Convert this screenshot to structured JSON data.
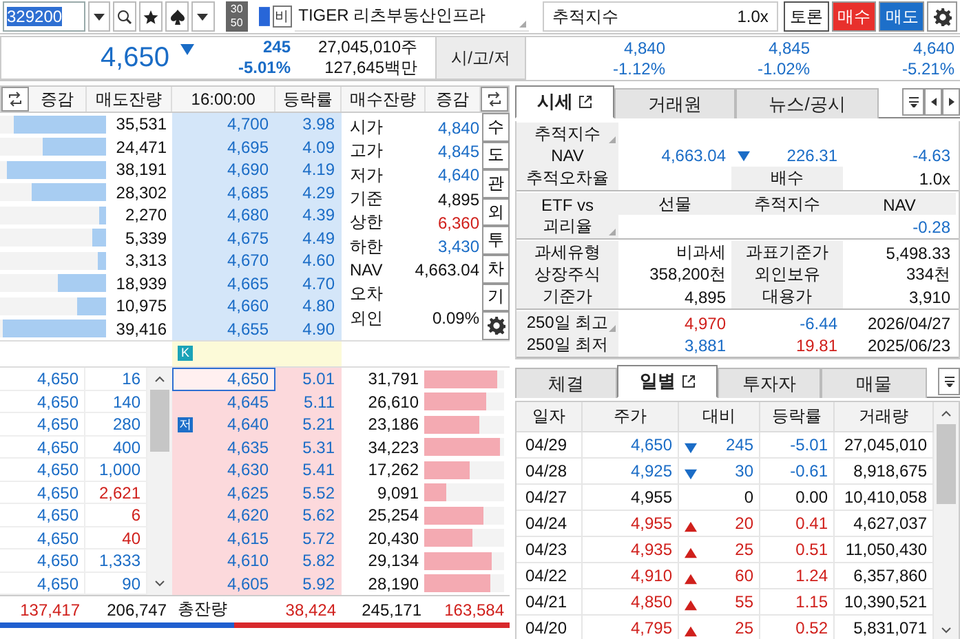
{
  "toolbar": {
    "code": "329200",
    "badge": [
      "30",
      "50"
    ],
    "tag": "비",
    "name": "TIGER 리츠부동산인프라",
    "index_label": "추적지수",
    "multiplier": "1.0x",
    "buttons": [
      {
        "label": "토론",
        "kind": "plain"
      },
      {
        "label": "매수",
        "kind": "buy"
      },
      {
        "label": "매도",
        "kind": "sell"
      }
    ]
  },
  "quote": {
    "price": "4,650",
    "falling": true,
    "change": "245",
    "rate": "-5.01%",
    "volume": "27,045,010주",
    "amount": "127,645백만",
    "ohl_button": "시/고/저",
    "ohl": [
      {
        "price": "4,840",
        "rate": "-1.12%"
      },
      {
        "price": "4,845",
        "rate": "-1.02%"
      },
      {
        "price": "4,640",
        "rate": "-5.21%"
      }
    ]
  },
  "orderbook": {
    "columns": [
      "증감",
      "매도잔량",
      "16:00:00",
      "등락률",
      "매수잔량",
      "증감"
    ],
    "asks": [
      {
        "qty": "35,531",
        "price": "4,700",
        "rate": "3.98",
        "level": 0.87
      },
      {
        "qty": "24,471",
        "price": "4,695",
        "rate": "4.09",
        "level": 0.6
      },
      {
        "qty": "38,191",
        "price": "4,690",
        "rate": "4.19",
        "level": 0.94
      },
      {
        "qty": "28,302",
        "price": "4,685",
        "rate": "4.29",
        "level": 0.7
      },
      {
        "qty": "2,270",
        "price": "4,680",
        "rate": "4.39",
        "level": 0.06
      },
      {
        "qty": "5,339",
        "price": "4,675",
        "rate": "4.49",
        "level": 0.13
      },
      {
        "qty": "3,313",
        "price": "4,670",
        "rate": "4.60",
        "level": 0.08
      },
      {
        "qty": "18,939",
        "price": "4,665",
        "rate": "4.70",
        "level": 0.46
      },
      {
        "qty": "10,975",
        "price": "4,660",
        "rate": "4.80",
        "level": 0.27
      },
      {
        "qty": "39,416",
        "price": "4,655",
        "rate": "4.90",
        "level": 0.97
      }
    ],
    "info": [
      {
        "label": "시가",
        "value": "4,840",
        "color": "#1a6cc6"
      },
      {
        "label": "고가",
        "value": "4,845",
        "color": "#1a6cc6"
      },
      {
        "label": "저가",
        "value": "4,640",
        "color": "#1a6cc6"
      },
      {
        "label": "기준",
        "value": "4,895",
        "color": "#111111"
      },
      {
        "label": "상한",
        "value": "6,360",
        "color": "#d0201c"
      },
      {
        "label": "하한",
        "value": "3,430",
        "color": "#1a6cc6"
      },
      {
        "label": "NAV",
        "value": "4,663.04",
        "color": "#111111"
      },
      {
        "label": "오차"
      },
      {
        "label": "외인",
        "value": "0.09%",
        "color": "#111111"
      }
    ],
    "side_buttons": [
      "수",
      "도",
      "관",
      "외",
      "투",
      "차",
      "기"
    ],
    "marker": "K",
    "bids": [
      {
        "price": "4,650",
        "rate": "5.01",
        "qty": "31,791",
        "level": 0.92,
        "current": true
      },
      {
        "price": "4,645",
        "rate": "5.11",
        "qty": "26,610",
        "level": 0.78,
        "current": false
      },
      {
        "price": "4,640",
        "rate": "5.21",
        "qty": "23,186",
        "level": 0.69,
        "current": false,
        "badge": "저"
      },
      {
        "price": "4,635",
        "rate": "5.31",
        "qty": "34,223",
        "level": 0.95,
        "current": false
      },
      {
        "price": "4,630",
        "rate": "5.41",
        "qty": "17,262",
        "level": 0.57,
        "current": false
      },
      {
        "price": "4,625",
        "rate": "5.52",
        "qty": "9,091",
        "level": 0.28,
        "current": false
      },
      {
        "price": "4,620",
        "rate": "5.62",
        "qty": "25,254",
        "level": 0.74,
        "current": false
      },
      {
        "price": "4,615",
        "rate": "5.72",
        "qty": "20,430",
        "level": 0.6,
        "current": false
      },
      {
        "price": "4,610",
        "rate": "5.82",
        "qty": "29,134",
        "level": 0.85,
        "current": false
      },
      {
        "price": "4,605",
        "rate": "5.92",
        "qty": "28,190",
        "level": 0.82,
        "current": false
      }
    ],
    "trades": [
      {
        "price": "4,650",
        "qty": "16",
        "color": "#1a6cc6"
      },
      {
        "price": "4,650",
        "qty": "140",
        "color": "#1a6cc6"
      },
      {
        "price": "4,650",
        "qty": "280",
        "color": "#1a6cc6"
      },
      {
        "price": "4,650",
        "qty": "400",
        "color": "#1a6cc6"
      },
      {
        "price": "4,650",
        "qty": "1,000",
        "color": "#1a6cc6"
      },
      {
        "price": "4,650",
        "qty": "2,621",
        "color": "#d0201c"
      },
      {
        "price": "4,650",
        "qty": "6",
        "color": "#d0201c"
      },
      {
        "price": "4,650",
        "qty": "40",
        "color": "#d0201c"
      },
      {
        "price": "4,650",
        "qty": "1,333",
        "color": "#1a6cc6"
      },
      {
        "price": "4,650",
        "qty": "90",
        "color": "#1a6cc6"
      }
    ],
    "totals": [
      {
        "kind": "value",
        "text": "137,417",
        "color": "#d0201c"
      },
      {
        "kind": "value",
        "text": "206,747",
        "color": "#111111"
      },
      {
        "kind": "label",
        "text": "총잔량"
      },
      {
        "kind": "value",
        "text": "38,424",
        "color": "#d0201c"
      },
      {
        "kind": "value",
        "text": "245,171",
        "color": "#111111"
      },
      {
        "kind": "value",
        "text": "163,584",
        "color": "#d0201c"
      }
    ],
    "balance": {
      "level": 0.46
    }
  },
  "detail": {
    "tabs": [
      {
        "label": "시세",
        "selected": true
      },
      {
        "label": "거래원",
        "selected": false
      },
      {
        "label": "뉴스/공시",
        "selected": false
      }
    ],
    "sections": [
      {
        "rows": [
          [
            {
              "kind": "label",
              "text": "추적지수",
              "corner": true
            },
            {
              "kind": "blank"
            },
            {
              "kind": "blank"
            },
            {
              "kind": "blank"
            }
          ],
          [
            {
              "kind": "label",
              "text": "NAV"
            },
            {
              "kind": "value",
              "text": "4,663.04",
              "color": "#1a6cc6"
            },
            {
              "kind": "value",
              "text": "226.31",
              "color": "#1a6cc6",
              "arrow": true
            },
            {
              "kind": "value",
              "text": "-4.63",
              "color": "#1a6cc6"
            }
          ],
          [
            {
              "kind": "label",
              "text": "추적오차율"
            },
            {
              "kind": "blank"
            },
            {
              "kind": "label",
              "text": "배수"
            },
            {
              "kind": "value",
              "text": "1.0x",
              "color": "#111111"
            }
          ]
        ]
      },
      {
        "rows": [
          [
            {
              "kind": "head",
              "text": "ETF vs"
            },
            {
              "kind": "head",
              "text": "선물"
            },
            {
              "kind": "head",
              "text": "추적지수"
            },
            {
              "kind": "head",
              "text": "NAV"
            }
          ],
          [
            {
              "kind": "label",
              "text": "괴리율",
              "corner": true
            },
            {
              "kind": "blank"
            },
            {
              "kind": "blank"
            },
            {
              "kind": "value",
              "text": "-0.28",
              "color": "#1a6cc6"
            }
          ]
        ]
      },
      {
        "rows": [
          [
            {
              "kind": "label",
              "text": "과세유형"
            },
            {
              "kind": "value",
              "text": "비과세",
              "color": "#111111"
            },
            {
              "kind": "label",
              "text": "과표기준가"
            },
            {
              "kind": "value",
              "text": "5,498.33",
              "color": "#111111"
            }
          ],
          [
            {
              "kind": "label",
              "text": "상장주식"
            },
            {
              "kind": "value",
              "text": "358,200천",
              "color": "#111111"
            },
            {
              "kind": "label",
              "text": "외인보유"
            },
            {
              "kind": "value",
              "text": "334천",
              "color": "#111111"
            }
          ],
          [
            {
              "kind": "label",
              "text": "기준가"
            },
            {
              "kind": "value",
              "text": "4,895",
              "color": "#111111"
            },
            {
              "kind": "label",
              "text": "대용가"
            },
            {
              "kind": "value",
              "text": "3,910",
              "color": "#111111"
            }
          ]
        ]
      },
      {
        "rows": [
          [
            {
              "kind": "label",
              "text": "250일 최고",
              "corner": true
            },
            {
              "kind": "value",
              "text": "4,970",
              "color": "#d0201c"
            },
            {
              "kind": "value",
              "text": "-6.44",
              "color": "#1a6cc6"
            },
            {
              "kind": "value",
              "text": "2026/04/27",
              "color": "#111111"
            }
          ],
          [
            {
              "kind": "label",
              "text": "250일 최저"
            },
            {
              "kind": "value",
              "text": "3,881",
              "color": "#1a6cc6"
            },
            {
              "kind": "value",
              "text": "19.81",
              "color": "#d0201c"
            },
            {
              "kind": "value",
              "text": "2025/06/23",
              "color": "#111111"
            }
          ]
        ]
      }
    ]
  },
  "daily": {
    "tabs": [
      {
        "label": "체결",
        "selected": false
      },
      {
        "label": "일별",
        "selected": true
      },
      {
        "label": "투자자",
        "selected": false
      },
      {
        "label": "매물",
        "selected": false
      }
    ],
    "columns": [
      "일자",
      "주가",
      "대비",
      "등락률",
      "거래량"
    ],
    "rows": [
      {
        "date": "04/29",
        "price": "4,650",
        "kind": "fall",
        "change": "245",
        "rate": "-5.01",
        "volume": "27,045,010"
      },
      {
        "date": "04/28",
        "price": "4,925",
        "kind": "fall",
        "change": "30",
        "rate": "-0.61",
        "volume": "8,918,675"
      },
      {
        "date": "04/27",
        "price": "4,955",
        "kind": "even",
        "change": "0",
        "rate": "0.00",
        "volume": "10,410,058"
      },
      {
        "date": "04/24",
        "price": "4,955",
        "kind": "rise",
        "change": "20",
        "rate": "0.41",
        "volume": "4,627,037"
      },
      {
        "date": "04/23",
        "price": "4,935",
        "kind": "rise",
        "change": "25",
        "rate": "0.51",
        "volume": "11,050,430"
      },
      {
        "date": "04/22",
        "price": "4,910",
        "kind": "rise",
        "change": "60",
        "rate": "1.24",
        "volume": "6,357,860"
      },
      {
        "date": "04/21",
        "price": "4,850",
        "kind": "rise",
        "change": "55",
        "rate": "1.15",
        "volume": "10,390,521"
      },
      {
        "date": "04/20",
        "price": "4,795",
        "kind": "rise",
        "change": "25",
        "rate": "0.52",
        "volume": "5,831,071"
      }
    ]
  }
}
